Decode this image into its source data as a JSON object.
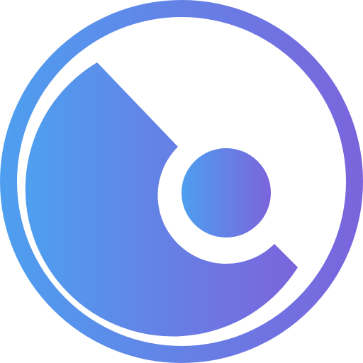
{
  "icon": {
    "name": "disc-icon",
    "colors": {
      "gradient_start": "#4e9ff0",
      "gradient_end": "#7b64dc",
      "background": "#ffffff"
    }
  }
}
